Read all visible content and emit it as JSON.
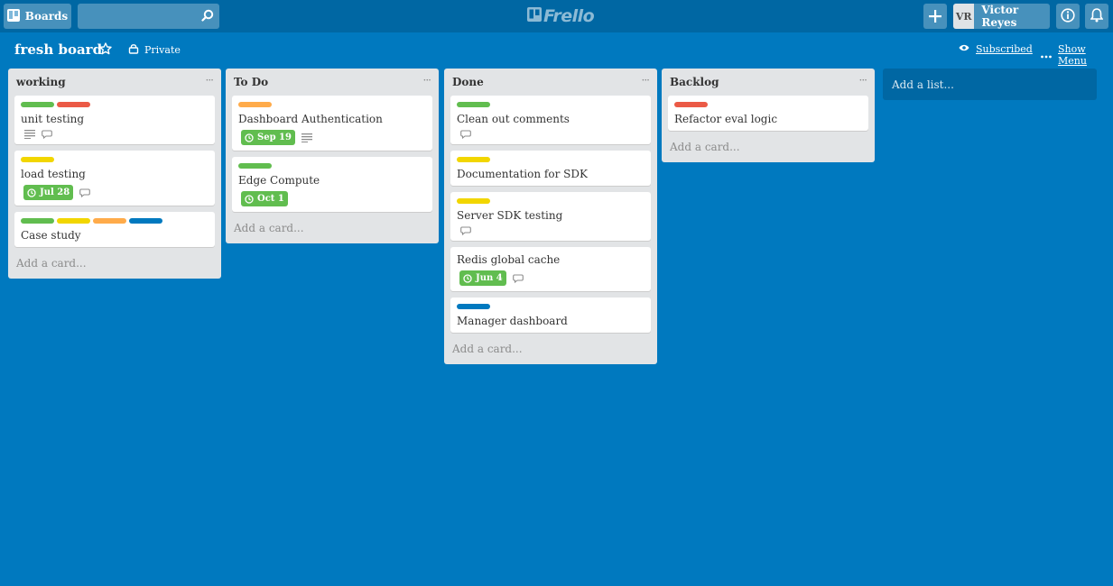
{
  "header": {
    "boards_label": "Boards",
    "search_value": "",
    "logo_text": "Frello",
    "user_initials": "VR",
    "user_name": "Victor Reyes"
  },
  "board": {
    "title": "fresh board",
    "visibility": "Private",
    "subscribed_label": "Subscribed",
    "show_menu_label": "Show Menu"
  },
  "colors": {
    "background": "#0079bf",
    "green": "#61bd4f",
    "red": "#eb5a46",
    "yellow": "#f2d600",
    "orange": "#ffab4a",
    "blue": "#0079bf"
  },
  "lists": [
    {
      "title": "working",
      "menu": "···",
      "add_card": "Add a card...",
      "cards": [
        {
          "title": "unit testing",
          "labels": [
            "green",
            "red"
          ],
          "due": "",
          "description": true,
          "comments": true
        },
        {
          "title": "load testing",
          "labels": [
            "yellow"
          ],
          "due": "Jul 28",
          "description": false,
          "comments": true
        },
        {
          "title": "Case study",
          "labels": [
            "green",
            "yellow",
            "orange",
            "blue"
          ],
          "due": "",
          "description": false,
          "comments": false
        }
      ]
    },
    {
      "title": "To Do",
      "menu": "···",
      "add_card": "Add a card...",
      "cards": [
        {
          "title": "Dashboard Authentication",
          "labels": [
            "orange"
          ],
          "due": "Sep 19",
          "description": true,
          "comments": false
        },
        {
          "title": "Edge Compute",
          "labels": [
            "green"
          ],
          "due": "Oct 1",
          "description": false,
          "comments": false
        }
      ]
    },
    {
      "title": "Done",
      "menu": "···",
      "add_card": "Add a card...",
      "cards": [
        {
          "title": "Clean out comments",
          "labels": [
            "green"
          ],
          "due": "",
          "description": false,
          "comments": true
        },
        {
          "title": "Documentation for SDK",
          "labels": [
            "yellow"
          ],
          "due": "",
          "description": false,
          "comments": false
        },
        {
          "title": "Server SDK testing",
          "labels": [
            "yellow"
          ],
          "due": "",
          "description": false,
          "comments": true
        },
        {
          "title": "Redis global cache",
          "labels": [],
          "due": "Jun 4",
          "description": false,
          "comments": true
        },
        {
          "title": "Manager dashboard",
          "labels": [
            "blue"
          ],
          "due": "",
          "description": false,
          "comments": false
        }
      ]
    },
    {
      "title": "Backlog",
      "menu": "···",
      "add_card": "Add a card...",
      "cards": [
        {
          "title": "Refactor eval logic",
          "labels": [
            "red"
          ],
          "due": "",
          "description": false,
          "comments": false
        }
      ]
    }
  ],
  "add_list_label": "Add a list..."
}
